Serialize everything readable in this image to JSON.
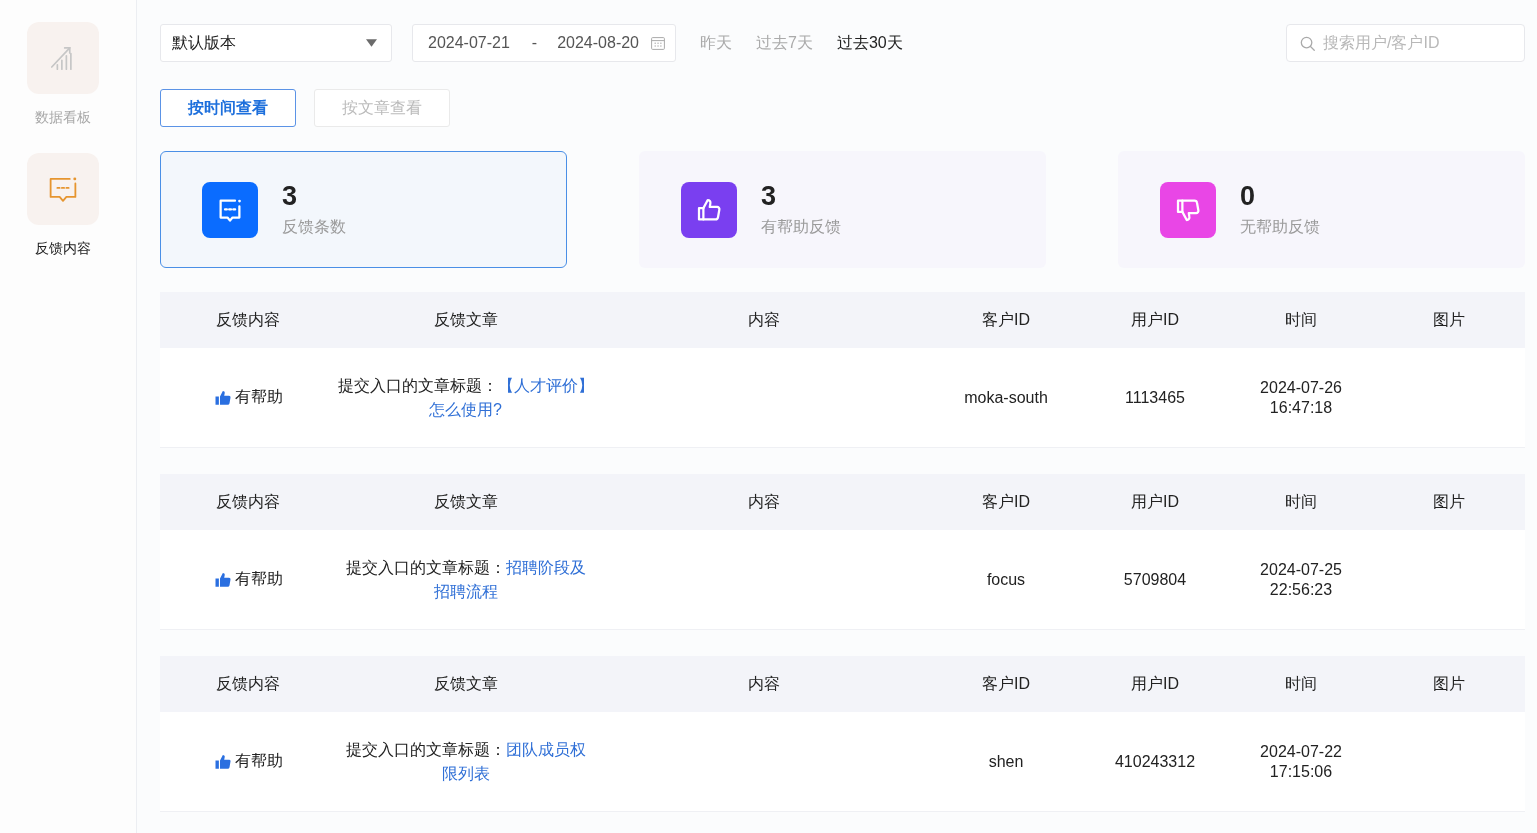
{
  "sidebar": {
    "items": [
      {
        "kind": "dashboard",
        "label": "数据看板",
        "selected": false
      },
      {
        "kind": "feedback",
        "label": "反馈内容",
        "selected": true
      }
    ]
  },
  "filters": {
    "version": {
      "value": "默认版本"
    },
    "date_range": {
      "start": "2024-07-21",
      "separator": "-",
      "end": "2024-08-20"
    },
    "quick_ranges": [
      {
        "label": "昨天",
        "selected": false
      },
      {
        "label": "过去7天",
        "selected": false
      },
      {
        "label": "过去30天",
        "selected": true
      }
    ],
    "search": {
      "placeholder": "搜索用户/客户ID"
    }
  },
  "view_tabs": [
    {
      "label": "按时间查看",
      "selected": true
    },
    {
      "label": "按文章查看",
      "selected": false
    }
  ],
  "stats": [
    {
      "kind": "count",
      "value": "3",
      "label": "反馈条数",
      "color": "#0a6cff",
      "selected": true
    },
    {
      "kind": "helpful",
      "value": "3",
      "label": "有帮助反馈",
      "color": "#7a3ff0",
      "selected": false
    },
    {
      "kind": "unhelpful",
      "value": "0",
      "label": "无帮助反馈",
      "color": "#e946e6",
      "selected": false
    }
  ],
  "feedback_table": {
    "groups": [
      {
        "columns": [
          "反馈内容",
          "反馈文章",
          "内容",
          "客户ID",
          "用户ID",
          "时间",
          "图片"
        ],
        "row": {
          "feedback": {
            "kind": "helpful",
            "label": "有帮助"
          },
          "article": {
            "prefix": "提交入口的文章标题：",
            "title_lines": [
              "【人才评价】",
              "怎么使用?"
            ]
          },
          "customer_id": "moka-south",
          "user_id": "1113465",
          "time": "2024-07-26 16:47:18"
        }
      },
      {
        "columns": [
          "反馈内容",
          "反馈文章",
          "内容",
          "客户ID",
          "用户ID",
          "时间",
          "图片"
        ],
        "row": {
          "feedback": {
            "kind": "helpful",
            "label": "有帮助"
          },
          "article": {
            "prefix": "提交入口的文章标题：",
            "title_lines": [
              "招聘阶段及",
              "招聘流程"
            ]
          },
          "customer_id": "focus",
          "user_id": "5709804",
          "time": "2024-07-25 22:56:23"
        }
      },
      {
        "columns": [
          "反馈内容",
          "反馈文章",
          "内容",
          "客户ID",
          "用户ID",
          "时间",
          "图片"
        ],
        "row": {
          "feedback": {
            "kind": "helpful",
            "label": "有帮助"
          },
          "article": {
            "prefix": "提交入口的文章标题：",
            "title_lines": [
              "团队成员权",
              "限列表"
            ]
          },
          "customer_id": "shen",
          "user_id": "410243312",
          "time": "2024-07-22 17:15:06"
        }
      }
    ]
  }
}
